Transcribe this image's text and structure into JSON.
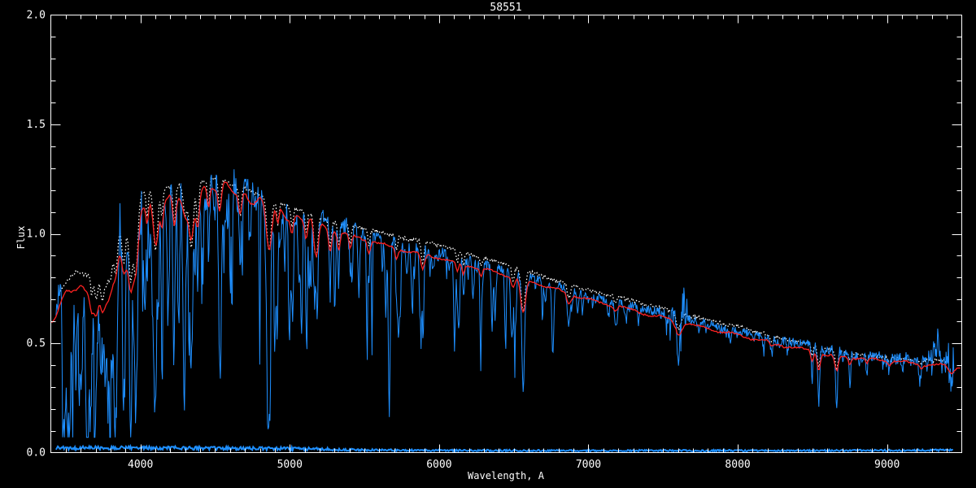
{
  "window": {
    "background": "#000000"
  },
  "chart_data": {
    "type": "line",
    "title": "58551",
    "xlabel": "Wavelength, A",
    "ylabel": "Flux",
    "xlim": [
      3400,
      9500
    ],
    "ylim": [
      0.0,
      2.0
    ],
    "x_major_ticks": [
      4000,
      5000,
      6000,
      7000,
      8000,
      9000
    ],
    "x_tick_labels": [
      "4000",
      "5000",
      "6000",
      "7000",
      "8000",
      "9000"
    ],
    "x_minor_step": 100,
    "y_major_ticks": [
      0.0,
      0.5,
      1.0,
      1.5,
      2.0
    ],
    "y_tick_labels": [
      "0.0",
      "0.5",
      "1.0",
      "1.5",
      "2.0"
    ],
    "y_minor_step": 0.1,
    "grid": false,
    "axis_color": "#ffffff",
    "background_color": "#000000",
    "seed": 58551,
    "series": [
      {
        "name": "observed-spectrum",
        "color": "#1e8fff",
        "style": "solid-jagged",
        "role": "data"
      },
      {
        "name": "template-spectrum",
        "color": "#ffffff",
        "style": "dotted",
        "role": "overlay"
      },
      {
        "name": "model-fit",
        "color": "#ff2222",
        "style": "solid-smooth",
        "role": "fit"
      },
      {
        "name": "error-spectrum",
        "color": "#1e8fff",
        "style": "solid",
        "role": "noise-floor",
        "approx_level": 0.02
      }
    ],
    "continuum_envelope": [
      [
        3400,
        0.66
      ],
      [
        3450,
        0.73
      ],
      [
        3500,
        0.78
      ],
      [
        3550,
        0.83
      ],
      [
        3600,
        0.86
      ],
      [
        3650,
        0.88
      ],
      [
        3700,
        0.93
      ],
      [
        3750,
        0.97
      ],
      [
        3800,
        1.01
      ],
      [
        3850,
        1.07
      ],
      [
        3900,
        1.12
      ],
      [
        3950,
        1.16
      ],
      [
        4000,
        1.19
      ],
      [
        4050,
        1.21
      ],
      [
        4100,
        1.21
      ],
      [
        4200,
        1.22
      ],
      [
        4300,
        1.23
      ],
      [
        4400,
        1.24
      ],
      [
        4500,
        1.26
      ],
      [
        4550,
        1.25
      ],
      [
        4600,
        1.23
      ],
      [
        4700,
        1.21
      ],
      [
        4800,
        1.18
      ],
      [
        4900,
        1.15
      ],
      [
        5000,
        1.12
      ],
      [
        5100,
        1.1
      ],
      [
        5200,
        1.08
      ],
      [
        5300,
        1.05
      ],
      [
        5400,
        1.03
      ],
      [
        5500,
        1.01
      ],
      [
        5600,
        0.99
      ],
      [
        5700,
        0.97
      ],
      [
        5800,
        0.95
      ],
      [
        5900,
        0.94
      ],
      [
        6000,
        0.92
      ],
      [
        6100,
        0.9
      ],
      [
        6200,
        0.88
      ],
      [
        6300,
        0.86
      ],
      [
        6400,
        0.84
      ],
      [
        6500,
        0.82
      ],
      [
        6600,
        0.8
      ],
      [
        6700,
        0.78
      ],
      [
        6800,
        0.76
      ],
      [
        6900,
        0.74
      ],
      [
        7000,
        0.72
      ],
      [
        7100,
        0.7
      ],
      [
        7200,
        0.69
      ],
      [
        7300,
        0.67
      ],
      [
        7400,
        0.65
      ],
      [
        7500,
        0.64
      ],
      [
        7600,
        0.62
      ],
      [
        7700,
        0.6
      ],
      [
        7800,
        0.59
      ],
      [
        7900,
        0.57
      ],
      [
        8000,
        0.56
      ],
      [
        8100,
        0.54
      ],
      [
        8200,
        0.53
      ],
      [
        8300,
        0.51
      ],
      [
        8400,
        0.5
      ],
      [
        8500,
        0.49
      ],
      [
        8600,
        0.47
      ],
      [
        8700,
        0.46
      ],
      [
        8800,
        0.45
      ],
      [
        8900,
        0.44
      ],
      [
        9000,
        0.43
      ],
      [
        9100,
        0.43
      ],
      [
        9200,
        0.42
      ],
      [
        9300,
        0.42
      ],
      [
        9400,
        0.42
      ],
      [
        9500,
        0.41
      ]
    ],
    "absorption_lines": [
      [
        3646,
        0.18,
        28
      ],
      [
        3674,
        0.4,
        6
      ],
      [
        3697,
        0.44,
        6
      ],
      [
        3712,
        0.46,
        6
      ],
      [
        3734,
        0.5,
        7
      ],
      [
        3750,
        0.52,
        7
      ],
      [
        3771,
        0.54,
        8
      ],
      [
        3798,
        0.56,
        9
      ],
      [
        3835,
        0.6,
        10
      ],
      [
        3889,
        0.62,
        10
      ],
      [
        3934,
        0.85,
        9
      ],
      [
        3969,
        0.84,
        10
      ],
      [
        4045,
        0.3,
        5
      ],
      [
        4102,
        0.66,
        10
      ],
      [
        4144,
        0.3,
        5
      ],
      [
        4227,
        0.42,
        6
      ],
      [
        4300,
        0.32,
        9
      ],
      [
        4340,
        0.68,
        10
      ],
      [
        4383,
        0.42,
        6
      ],
      [
        4455,
        0.28,
        5
      ],
      [
        4531,
        0.3,
        6
      ],
      [
        4668,
        0.3,
        6
      ],
      [
        4861,
        0.58,
        10
      ],
      [
        4920,
        0.25,
        5
      ],
      [
        5015,
        0.22,
        5
      ],
      [
        5110,
        0.25,
        5
      ],
      [
        5167,
        0.36,
        6
      ],
      [
        5183,
        0.38,
        6
      ],
      [
        5270,
        0.32,
        6
      ],
      [
        5328,
        0.28,
        5
      ],
      [
        5405,
        0.22,
        5
      ],
      [
        5530,
        0.2,
        5
      ],
      [
        5715,
        0.18,
        5
      ],
      [
        5890,
        0.28,
        7
      ],
      [
        6122,
        0.16,
        5
      ],
      [
        6162,
        0.18,
        5
      ],
      [
        6280,
        0.14,
        5
      ],
      [
        6495,
        0.2,
        6
      ],
      [
        6563,
        0.66,
        9
      ],
      [
        6870,
        0.22,
        8
      ],
      [
        7180,
        0.12,
        7
      ],
      [
        7605,
        0.32,
        11
      ],
      [
        8227,
        0.15,
        7
      ],
      [
        8498,
        0.32,
        5
      ],
      [
        8542,
        0.55,
        6
      ],
      [
        8662,
        0.55,
        6
      ],
      [
        8750,
        0.22,
        5
      ],
      [
        8865,
        0.2,
        5
      ],
      [
        9015,
        0.15,
        5
      ],
      [
        9230,
        0.12,
        6
      ],
      [
        9430,
        0.28,
        10
      ]
    ],
    "line_forest": {
      "blue_region": {
        "range": [
          3480,
          6800
        ],
        "count": 260,
        "depth_range": [
          0.04,
          0.46
        ],
        "width_range": [
          2,
          7
        ],
        "blue_weight_exp": 1.7
      },
      "red_region": {
        "range": [
          6800,
          9320
        ],
        "count": 60,
        "depth_range": [
          0.03,
          0.15
        ],
        "width_range": [
          2,
          6
        ]
      }
    },
    "noise_profile": [
      [
        3400,
        0.085
      ],
      [
        3800,
        0.095
      ],
      [
        4200,
        0.09
      ],
      [
        4600,
        0.075
      ],
      [
        5000,
        0.055
      ],
      [
        5400,
        0.04
      ],
      [
        5800,
        0.03
      ],
      [
        6200,
        0.024
      ],
      [
        6600,
        0.02
      ],
      [
        7000,
        0.018
      ],
      [
        7400,
        0.02
      ],
      [
        7600,
        0.045
      ],
      [
        7700,
        0.02
      ],
      [
        8000,
        0.018
      ],
      [
        8400,
        0.022
      ],
      [
        8800,
        0.024
      ],
      [
        9200,
        0.035
      ],
      [
        9300,
        0.06
      ],
      [
        9450,
        0.07
      ]
    ],
    "spike_regions": [
      {
        "range": [
          7590,
          7665
        ],
        "amplitude": 0.1
      },
      {
        "range": [
          9290,
          9455
        ],
        "amplitude": 0.12
      }
    ],
    "model_offset": [
      [
        3400,
        -0.055
      ],
      [
        3700,
        -0.1
      ],
      [
        4000,
        -0.06
      ],
      [
        4300,
        -0.035
      ],
      [
        4700,
        -0.03
      ],
      [
        5000,
        -0.035
      ],
      [
        5500,
        -0.035
      ],
      [
        6000,
        -0.03
      ],
      [
        6600,
        -0.015
      ],
      [
        7000,
        -0.02
      ],
      [
        7600,
        -0.02
      ],
      [
        8200,
        -0.02
      ],
      [
        8600,
        -0.025
      ],
      [
        9000,
        -0.01
      ],
      [
        9300,
        -0.02
      ],
      [
        9500,
        -0.02
      ]
    ],
    "template_offset": [
      [
        3400,
        -0.01
      ],
      [
        4500,
        -0.005
      ],
      [
        5300,
        0.0
      ],
      [
        5600,
        0.02
      ],
      [
        6000,
        0.028
      ],
      [
        6400,
        0.03
      ],
      [
        6800,
        0.022
      ],
      [
        7200,
        0.025
      ],
      [
        7600,
        0.02
      ],
      [
        8000,
        0.018
      ],
      [
        8300,
        0.008
      ],
      [
        8600,
        0.0
      ],
      [
        9000,
        0.002
      ],
      [
        9400,
        0.0
      ]
    ],
    "error_base": [
      [
        3430,
        0.02
      ],
      [
        4000,
        0.022
      ],
      [
        5000,
        0.018
      ],
      [
        5500,
        0.012
      ],
      [
        6000,
        0.01
      ],
      [
        7000,
        0.009
      ],
      [
        8000,
        0.009
      ],
      [
        9000,
        0.01
      ],
      [
        9450,
        0.012
      ]
    ],
    "error_amp": [
      [
        3430,
        0.009
      ],
      [
        5200,
        0.007
      ],
      [
        5600,
        0.004
      ],
      [
        9450,
        0.004
      ]
    ]
  }
}
